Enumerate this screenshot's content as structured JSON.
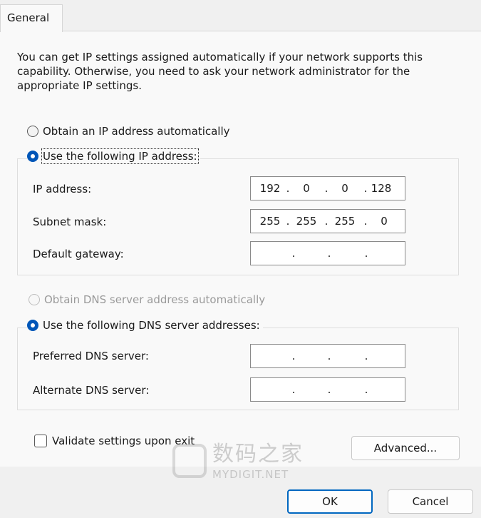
{
  "tabs": [
    {
      "label": "General"
    }
  ],
  "intro_text": "You can get IP settings assigned automatically if your network supports this capability. Otherwise, you need to ask your network administrator for the appropriate IP settings.",
  "ip": {
    "auto_label": "Obtain an IP address automatically",
    "manual_label": "Use the following IP address:",
    "address_label": "IP address:",
    "address": [
      "192",
      "0",
      "0",
      "128"
    ],
    "subnet_label": "Subnet mask:",
    "subnet": [
      "255",
      "255",
      "255",
      "0"
    ],
    "gateway_label": "Default gateway:",
    "gateway": [
      "",
      "",
      "",
      ""
    ]
  },
  "dns": {
    "auto_label": "Obtain DNS server address automatically",
    "manual_label": "Use the following DNS server addresses:",
    "preferred_label": "Preferred DNS server:",
    "preferred": [
      "",
      "",
      "",
      ""
    ],
    "alternate_label": "Alternate DNS server:",
    "alternate": [
      "",
      "",
      "",
      ""
    ]
  },
  "validate_label": "Validate settings upon exit",
  "validate_checked": false,
  "buttons": {
    "advanced": "Advanced...",
    "ok": "OK",
    "cancel": "Cancel"
  },
  "watermark": {
    "cn": "数码之家",
    "en": "MYDIGIT.NET"
  },
  "colors": {
    "accent": "#0067c0",
    "radio_checked": "#0056b8",
    "disabled": "#9a9a9a"
  }
}
